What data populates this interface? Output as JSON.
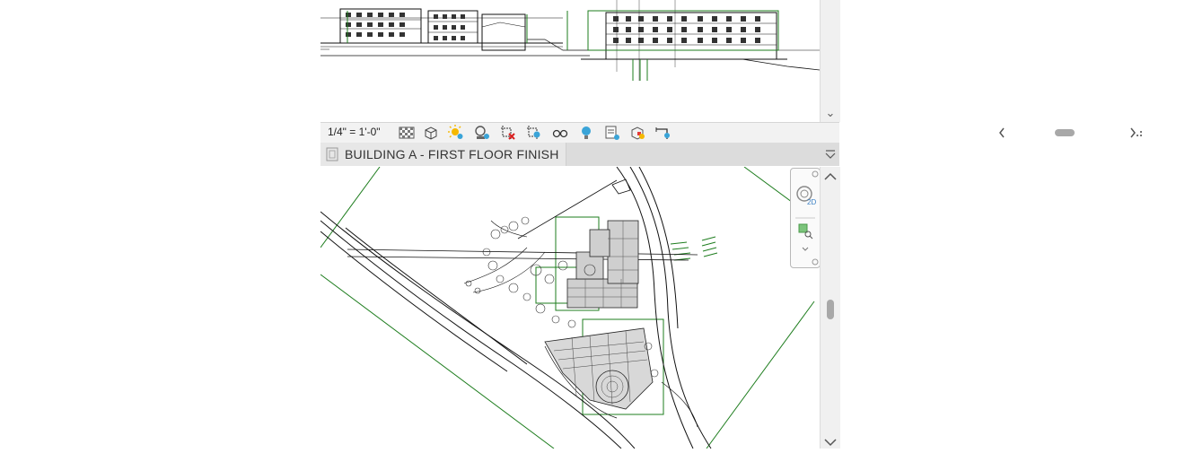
{
  "toolbar": {
    "scale": "1/4\" = 1'-0\"",
    "icons": [
      "detail-level-icon",
      "visual-style-icon",
      "sun-path-icon",
      "shadows-icon",
      "crop-view-icon",
      "show-crop-region-icon",
      "temporary-hide-icon",
      "reveal-hidden-icon",
      "temporary-properties-icon",
      "worksharing-display-icon",
      "analytical-model-icon"
    ]
  },
  "view2": {
    "title": "BUILDING A - FIRST FLOOR FINISH"
  },
  "navigation_bar": {
    "wheel_label": "2D"
  },
  "colors": {
    "line_green": "#1e7d1e",
    "ui_gray": "#f0f0f0",
    "tab_gray": "#e7e7e7"
  }
}
